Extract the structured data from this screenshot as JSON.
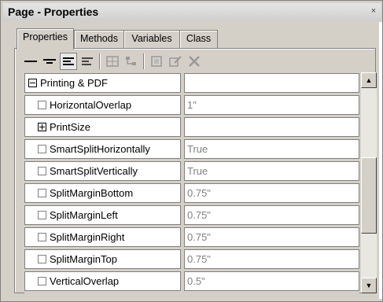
{
  "window": {
    "title": "Page - Properties",
    "close_glyph": "×"
  },
  "tabs": [
    {
      "label": "Properties",
      "active": true
    },
    {
      "label": "Methods",
      "active": false
    },
    {
      "label": "Variables",
      "active": false
    },
    {
      "label": "Class",
      "active": false
    }
  ],
  "toolbar": {
    "buttons": [
      {
        "icon": "single-line-icon"
      },
      {
        "icon": "short-lines-icon"
      },
      {
        "icon": "align-lines-icon",
        "pressed": true
      },
      {
        "icon": "left-align-lines-icon"
      },
      {
        "icon": "grid-icon"
      },
      {
        "icon": "tree-icon"
      },
      {
        "icon": "page-icon"
      },
      {
        "icon": "edit-icon"
      },
      {
        "icon": "delete-icon"
      }
    ]
  },
  "properties": {
    "rows": [
      {
        "kind": "group",
        "expander": "minus",
        "name": "Printing & PDF",
        "value": ""
      },
      {
        "kind": "prop",
        "name": "HorizontalOverlap",
        "value": "1\""
      },
      {
        "kind": "group",
        "expander": "plus",
        "name": "PrintSize",
        "value": ""
      },
      {
        "kind": "prop",
        "name": "SmartSplitHorizontally",
        "value": "True"
      },
      {
        "kind": "prop",
        "name": "SmartSplitVertically",
        "value": "True"
      },
      {
        "kind": "prop",
        "name": "SplitMarginBottom",
        "value": "0.75\""
      },
      {
        "kind": "prop",
        "name": "SplitMarginLeft",
        "value": "0.75\""
      },
      {
        "kind": "prop",
        "name": "SplitMarginRight",
        "value": "0.75\""
      },
      {
        "kind": "prop",
        "name": "SplitMarginTop",
        "value": "0.75\""
      },
      {
        "kind": "prop",
        "name": "VerticalOverlap",
        "value": "0.5\""
      }
    ]
  },
  "scrollbar": {
    "up_glyph": "▲",
    "down_glyph": "▼"
  }
}
